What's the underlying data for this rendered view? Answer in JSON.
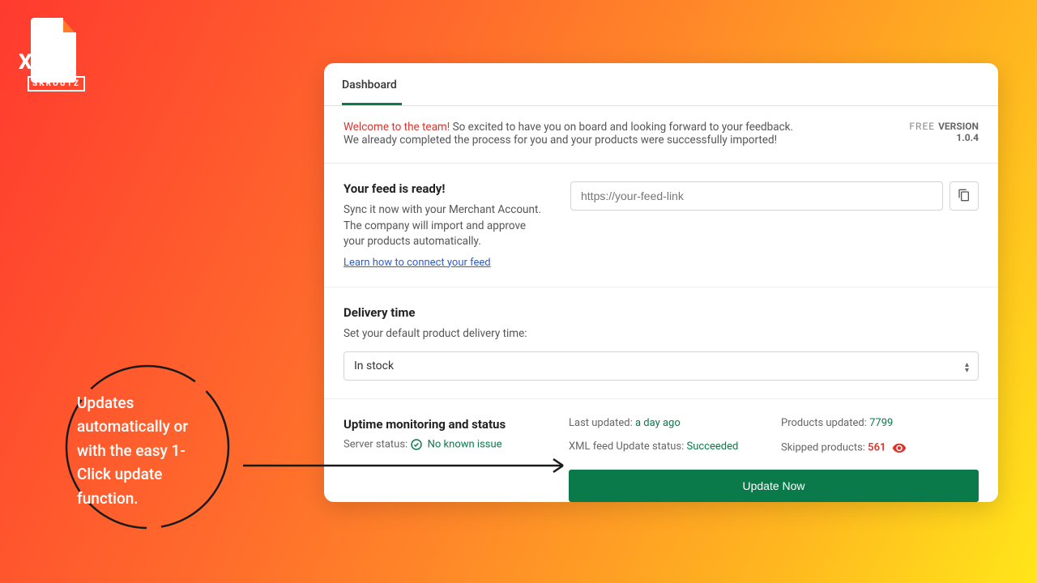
{
  "logo": {
    "xml": "XML",
    "skroutz": "SKROUTZ"
  },
  "tabs": {
    "dashboard": "Dashboard"
  },
  "welcome": {
    "prefix": "Welcome to the team!",
    "rest": " So excited to have you on board and looking forward to your feedback.",
    "line2": "We already completed the process for you and your products were successfully imported!"
  },
  "version": {
    "free": "FREE ",
    "label": "VERSION",
    "number": "1.0.4"
  },
  "feed": {
    "heading": "Your feed is ready!",
    "body": "Sync it now with your Merchant Account. The company will import and approve your products automatically.",
    "link": "Learn how to connect your feed",
    "placeholder": "https://your-feed-link"
  },
  "delivery": {
    "heading": "Delivery time",
    "sub": "Set your default product delivery time:",
    "selected": "In stock"
  },
  "status": {
    "heading": "Uptime monitoring and status",
    "server_label": "Server status:  ",
    "server_value": "No known issue",
    "last_label": "Last updated: ",
    "last_value": "a day ago",
    "xml_label": "XML feed Update status: ",
    "xml_value": "Succeeded",
    "prod_label": "Products updated: ",
    "prod_value": "7799",
    "skip_label": "Skipped products:  ",
    "skip_value": "561",
    "button": "Update Now"
  },
  "callout": "Updates automatically or with the easy 1-Click update function."
}
